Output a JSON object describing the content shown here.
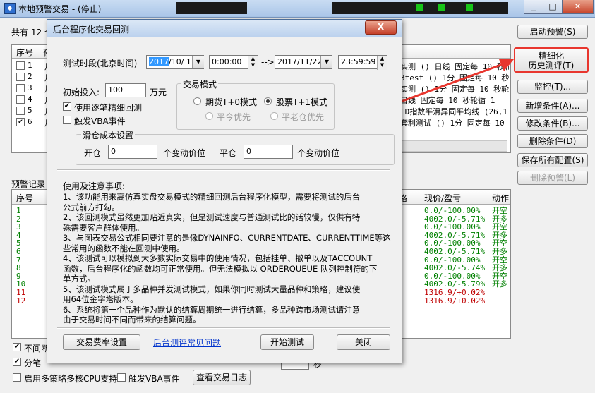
{
  "main": {
    "title": "本地预警交易 - (停止)",
    "count_prefix": "共有 12 个",
    "buttons": {
      "start_alert": "启动预警(S)",
      "fine_backtest": "精细化\n历史测评(T)",
      "monitor": "监控(T)...",
      "add_condition": "新增条件(A)...",
      "modify_condition": "修改条件(B)...",
      "delete_condition": "删除条件(D)",
      "save_all": "保存所有配置(S)",
      "delete_alert": "删除预警(L)",
      "view_log": "查看交易日志"
    },
    "top_table": {
      "headers": [
        "序号",
        "预"
      ],
      "rows": [
        {
          "no": "1",
          "checked": false,
          "prefix": "月",
          "desc": "实测 () 日线 固定每 10 秒轮"
        },
        {
          "no": "2",
          "checked": false,
          "prefix": "月",
          "desc": "3test () 1分 固定每 10 秒轮"
        },
        {
          "no": "3",
          "checked": false,
          "prefix": "月",
          "desc": "实测 () 1分 固定每 10 秒轮"
        },
        {
          "no": "4",
          "checked": false,
          "prefix": "月",
          "desc": "日线 固定每 10 秒轮循 1"
        },
        {
          "no": "5",
          "checked": false,
          "prefix": "月",
          "desc": "CD指数平滑异同平均线 (26,1"
        },
        {
          "no": "6",
          "checked": true,
          "prefix": "月",
          "desc": "套利测试 () 1分 固定每 10"
        }
      ]
    },
    "alert_label": "预警记录",
    "bottom_table": {
      "headers": [
        "序号",
        "格",
        "现价/盈亏",
        "动作"
      ],
      "rows": [
        {
          "no": "1",
          "price": "0.0/-100.00%",
          "action": "开空",
          "color": "#008000"
        },
        {
          "no": "2",
          "price": "4002.0/-5.71%",
          "action": "开多",
          "color": "#008000"
        },
        {
          "no": "3",
          "price": "0.0/-100.00%",
          "action": "开空",
          "color": "#008000"
        },
        {
          "no": "4",
          "price": "4002.0/-5.71%",
          "action": "开多",
          "color": "#008000"
        },
        {
          "no": "5",
          "price": "0.0/-100.00%",
          "action": "开空",
          "color": "#008000"
        },
        {
          "no": "6",
          "price": "4002.0/-5.71%",
          "action": "开多",
          "color": "#008000"
        },
        {
          "no": "7",
          "price": "0.0/-100.00%",
          "action": "开空",
          "color": "#008000"
        },
        {
          "no": "8",
          "price": "4002.0/-5.74%",
          "action": "开多",
          "color": "#008000"
        },
        {
          "no": "9",
          "price": "0.0/-100.00%",
          "action": "开空",
          "color": "#008000"
        },
        {
          "no": "10",
          "price": "4002.0/-5.79%",
          "action": "开多",
          "color": "#008000"
        },
        {
          "no": "11",
          "price": "1316.9/+0.02%",
          "action": "",
          "color": "#c00000"
        },
        {
          "no": "12",
          "price": "1316.9/+0.02%",
          "action": "",
          "color": "#c00000"
        }
      ]
    },
    "bottom_checks": {
      "no_interrupt": "不间断",
      "order_split": "分笔",
      "multi_core": "启用多策略多核CPU支持",
      "vba_event": "触发VBA事件"
    },
    "bottom_extra": "秒"
  },
  "dialog": {
    "title": "后台程序化交易回测",
    "close": "X",
    "period_label": "测试时段(北京时间)",
    "start_date_hl": "2017",
    "start_date_rest": "/10/ 1",
    "start_time": "0:00:00",
    "arrow": "-->",
    "end_date": "2017/11/22",
    "end_time": "23:59:59",
    "initial_label": "初始投入:",
    "initial_value": "100",
    "initial_unit": "万元",
    "use_fine": "使用逐笔精细回测",
    "use_fine_checked": true,
    "trigger_vba": "触发VBA事件",
    "trigger_vba_checked": false,
    "mode_group": "交易模式",
    "mode_futures": "期货T+0模式",
    "mode_stock": "股票T+1模式",
    "mode_flat_today": "平今优先",
    "mode_flat_old": "平老仓优先",
    "slip_group": "滑仓成本设置",
    "open_label": "开仓",
    "open_value": "0",
    "open_unit": "个变动价位",
    "close_label": "平仓",
    "close_value": "0",
    "close_unit": "个变动价位",
    "notes_title": "使用及注意事项:",
    "notes": [
      "1、该功能用来高仿真实盘交易模式的精细回测后台程序化模型，需要将测试的后台",
      "公式前方打勾。",
      "2、该回测模式虽然更加贴近真实，但是测试速度与普通测试比的话较慢，仅供有特",
      "殊需要客户群体使用。",
      "3、与图表交易公式相同要注意的是像DYNAINFO、CURRENTDATE、CURRENTTIME等这",
      "些常用的函数不能在回测中使用。",
      "4、该测试可以模拟到大多数实际交易中的使用情况，包括挂单、撤单以及TACCOUNT",
      "函数，后台程序化的函数均可正常使用。但无法模拟以 ORDERQUEUE 队列控制符的下",
      "单方式。",
      "5、该测试模式属于多品种并发测试模式，如果你同时测试大量品种和策略，建议使",
      "用64位金字塔版本。",
      "6、系统将第一个品种作为默认的结算周期统一进行结算，多品种跨市场测试请注意",
      "由于交易时间不同而带来的结算问题。"
    ],
    "fee_btn": "交易费率设置",
    "faq_link": "后台测评常见问题",
    "start_btn": "开始测试",
    "close_btn": "关闭"
  },
  "colors": {
    "accent_red": "#e8362e",
    "link": "#0033cc"
  }
}
